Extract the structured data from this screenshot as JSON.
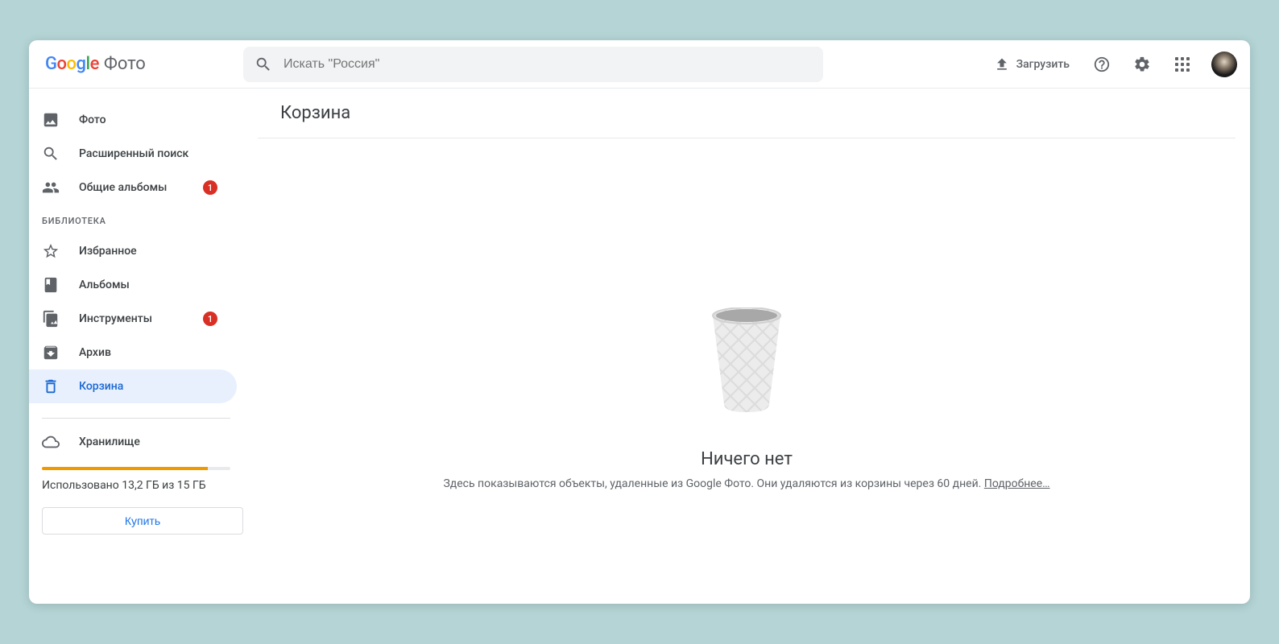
{
  "header": {
    "app_label": "Фото",
    "search_placeholder": "Искать \"Россия\"",
    "upload_label": "Загрузить"
  },
  "sidebar": {
    "items": [
      {
        "label": "Фото",
        "badge": null
      },
      {
        "label": "Расширенный поиск",
        "badge": null
      },
      {
        "label": "Общие альбомы",
        "badge": "1"
      }
    ],
    "library_label": "БИБЛИОТЕКА",
    "library_items": [
      {
        "label": "Избранное",
        "badge": null
      },
      {
        "label": "Альбомы",
        "badge": null
      },
      {
        "label": "Инструменты",
        "badge": "1"
      },
      {
        "label": "Архив",
        "badge": null
      },
      {
        "label": "Корзина",
        "badge": null
      }
    ],
    "storage": {
      "label": "Хранилище",
      "used_text": "Использовано 13,2 ГБ из 15 ГБ",
      "percent": 88,
      "buy_label": "Купить"
    }
  },
  "main": {
    "title": "Корзина",
    "empty_title": "Ничего нет",
    "empty_sub": "Здесь показываются объекты, удаленные из Google Фото. Они удаляются из корзины через 60 дней. ",
    "learn_more": "Подробнее…"
  }
}
